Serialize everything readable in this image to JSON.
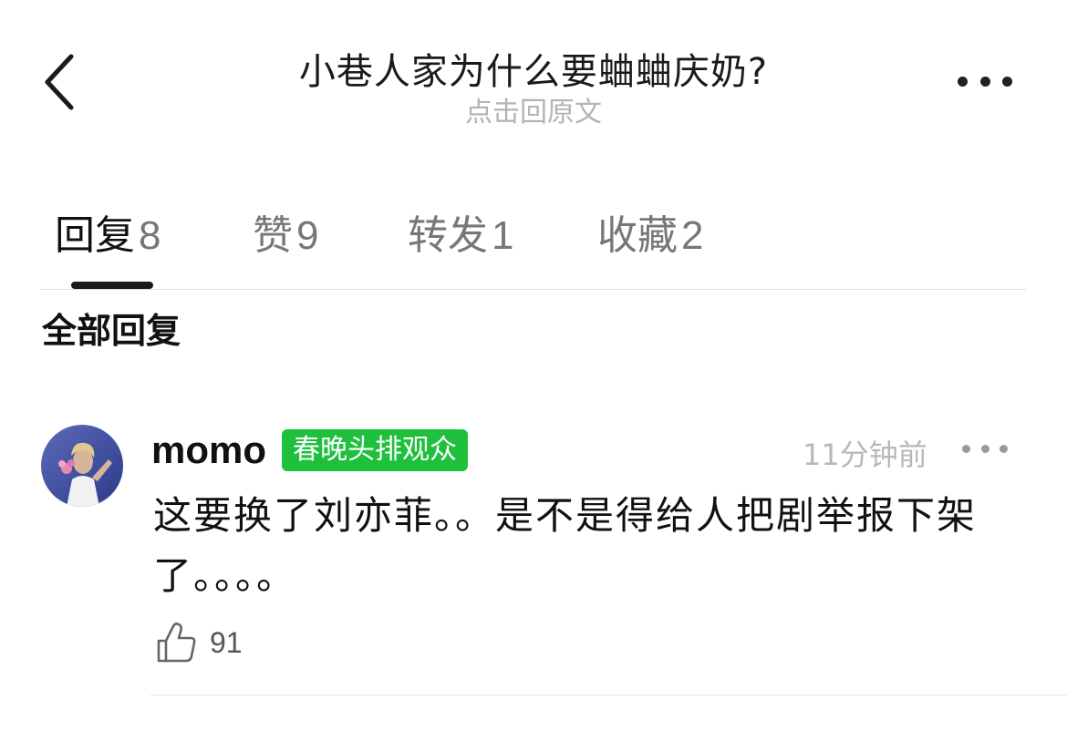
{
  "header": {
    "title": "小巷人家为什么要蛐蛐庆奶?",
    "subtitle": "点击回原文"
  },
  "tabs": [
    {
      "label": "回复",
      "count": "8",
      "active": true
    },
    {
      "label": "赞",
      "count": "9",
      "active": false
    },
    {
      "label": "转发",
      "count": "1",
      "active": false
    },
    {
      "label": "收藏",
      "count": "2",
      "active": false
    }
  ],
  "section_title": "全部回复",
  "comment": {
    "username": "momo",
    "badge": "春晚头排观众",
    "timestamp": "11分钟前",
    "text": "这要换了刘亦菲。。是不是得给人把剧举报下架了。。。。",
    "likes": "91"
  },
  "colors": {
    "badge_bg": "#1ec03c",
    "muted_text": "#b3b3b3",
    "primary_text": "#111111"
  }
}
